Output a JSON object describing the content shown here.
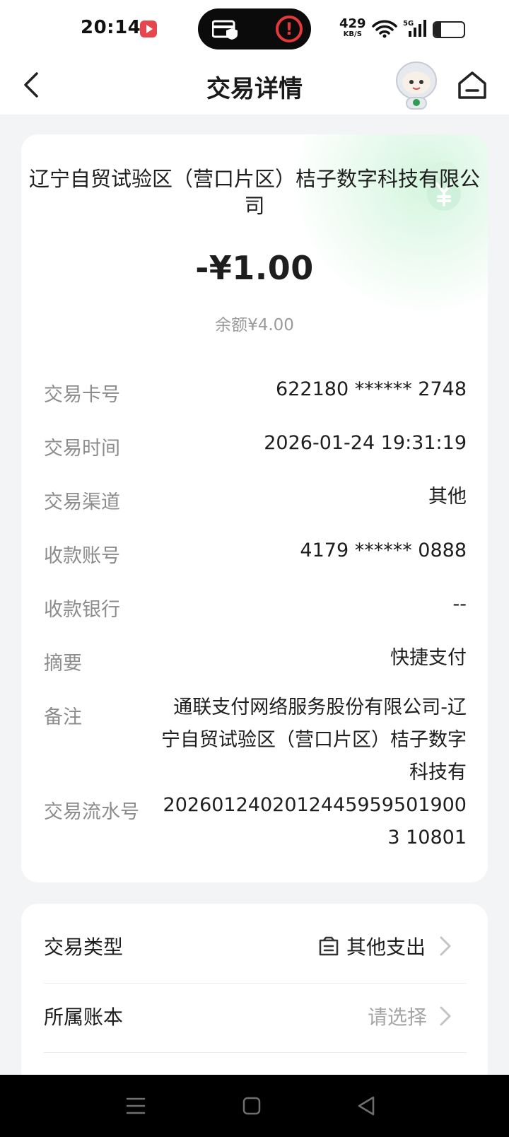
{
  "status_bar": {
    "time": "20:14",
    "net_speed_value": "429",
    "net_speed_unit": "KB/S",
    "network_type": "5G",
    "battery": "23",
    "battery_level": 0.23
  },
  "nav": {
    "title": "交易详情"
  },
  "transaction": {
    "merchant": "辽宁自贸试验区（营口片区）桔子数字科技有限公司",
    "amount": "-¥1.00",
    "balance": "余额¥4.00",
    "details": [
      {
        "label": "交易卡号",
        "value": "622180 ****** 2748"
      },
      {
        "label": "交易时间",
        "value": "2026-01-24 19:31:19"
      },
      {
        "label": "交易渠道",
        "value": "其他"
      },
      {
        "label": "收款账号",
        "value": "4179 ****** 0888"
      },
      {
        "label": "收款银行",
        "value": "--"
      },
      {
        "label": "摘要",
        "value": "快捷支付"
      },
      {
        "label": "备注",
        "value": "通联支付网络服务股份有限公司-辽宁自贸试验区（营口片区）桔子数字科技有"
      },
      {
        "label": "交易流水号",
        "value": "20260124020124459595019003 10801"
      }
    ]
  },
  "classification": {
    "type_label": "交易类型",
    "type_value": "其他支出",
    "book_label": "所属账本",
    "book_value": "请选择"
  },
  "icons": {
    "back": "chevron-left-icon",
    "mascot": "robot-mascot-icon",
    "home": "home-icon",
    "coin": "yuan-coin-icon",
    "type": "ledger-icon",
    "arrow": "chevron-right-icon"
  },
  "colors": {
    "background": "#f3f4f6",
    "card": "#ffffff",
    "accent_green": "#c9f0d6",
    "label_gray": "#8c8c8c",
    "alert_red": "#e5383b"
  }
}
